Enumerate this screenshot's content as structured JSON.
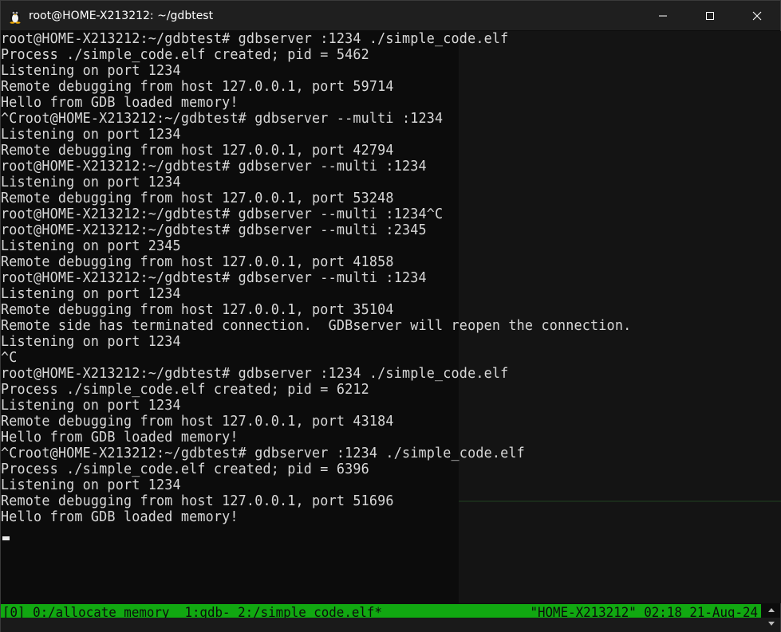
{
  "window": {
    "title": "root@HOME-X213212: ~/gdbtest",
    "controls": {
      "minimize_icon": "minimize-icon",
      "maximize_icon": "maximize-icon",
      "close_icon": "close-icon"
    }
  },
  "terminal": {
    "lines": [
      "root@HOME-X213212:~/gdbtest# gdbserver :1234 ./simple_code.elf",
      "Process ./simple_code.elf created; pid = 5462",
      "Listening on port 1234",
      "Remote debugging from host 127.0.0.1, port 59714",
      "Hello from GDB loaded memory!",
      "^Croot@HOME-X213212:~/gdbtest# gdbserver --multi :1234",
      "Listening on port 1234",
      "Remote debugging from host 127.0.0.1, port 42794",
      "root@HOME-X213212:~/gdbtest# gdbserver --multi :1234",
      "Listening on port 1234",
      "Remote debugging from host 127.0.0.1, port 53248",
      "root@HOME-X213212:~/gdbtest# gdbserver --multi :1234^C",
      "root@HOME-X213212:~/gdbtest# gdbserver --multi :2345",
      "Listening on port 2345",
      "Remote debugging from host 127.0.0.1, port 41858",
      "root@HOME-X213212:~/gdbtest# gdbserver --multi :1234",
      "Listening on port 1234",
      "Remote debugging from host 127.0.0.1, port 35104",
      "Remote side has terminated connection.  GDBserver will reopen the connection.",
      "Listening on port 1234",
      "^C",
      "root@HOME-X213212:~/gdbtest# gdbserver :1234 ./simple_code.elf",
      "Process ./simple_code.elf created; pid = 6212",
      "Listening on port 1234",
      "Remote debugging from host 127.0.0.1, port 43184",
      "Hello from GDB loaded memory!",
      "^Croot@HOME-X213212:~/gdbtest# gdbserver :1234 ./simple_code.elf",
      "Process ./simple_code.elf created; pid = 6396",
      "Listening on port 1234",
      "Remote debugging from host 127.0.0.1, port 51696",
      "Hello from GDB loaded memory!"
    ]
  },
  "statusbar": {
    "left": "[0] 0:/allocate_memory  1:gdb- 2:/simple_code.elf*",
    "right": "\"HOME-X213212\" 02:18 21-Aug-24",
    "color": "#11a811"
  },
  "colors": {
    "background": "#0c0c0c",
    "text": "#d8d8d8",
    "titlebar": "#1f1f1f"
  }
}
